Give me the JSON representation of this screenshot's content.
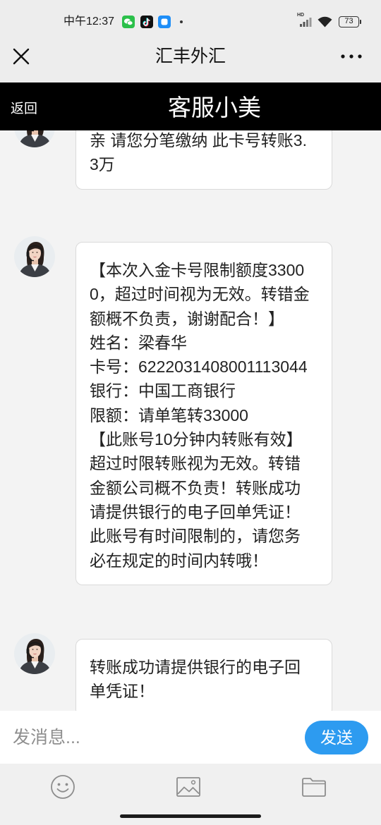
{
  "status_bar": {
    "time": "中午12:37",
    "notification_icons": [
      "wechat-icon",
      "tiktok-icon",
      "app-icon",
      "dot-icon"
    ],
    "network": "HD",
    "battery": "73",
    "status_icons": [
      "signal-icon",
      "wifi-icon",
      "battery-icon"
    ]
  },
  "title_bar": {
    "title": "汇丰外汇",
    "left_icon": "close-icon",
    "right_icon": "more-icon"
  },
  "header": {
    "back_label": "返回",
    "title": "客服小美"
  },
  "messages": [
    {
      "lines": [
        "亲 请您分笔缴纳 此卡号转账3.",
        "3万"
      ]
    },
    {
      "lines": [
        "【本次入金卡号限制额度3300",
        "0，超过时间视为无效。转错金",
        "额概不负责，谢谢配合！】",
        "姓名：梁春华",
        "卡号：6222031408001113044",
        "银行：中国工商银行",
        "限额：请单笔转33000",
        "【此账号10分钟内转账有效】",
        "超过时限转账视为无效。转错",
        "金额公司概不负责！转账成功",
        "请提供银行的电子回单凭证！",
        "此账号有时间限制的，请您务",
        "必在规定的时间内转哦！"
      ]
    },
    {
      "lines": [
        "转账成功请提供银行的电子回",
        "单凭证！"
      ]
    }
  ],
  "composer": {
    "placeholder": "发消息...",
    "value": "",
    "send_label": "发送"
  },
  "toolbar": {
    "icons": [
      "emoji-icon",
      "image-icon",
      "folder-icon"
    ]
  },
  "colors": {
    "accent": "#2d9bf0",
    "header_bg": "#000000",
    "top_bar_bg": "#ededed",
    "chat_bg": "#f3f3f3",
    "bubble_bg": "#ffffff"
  }
}
